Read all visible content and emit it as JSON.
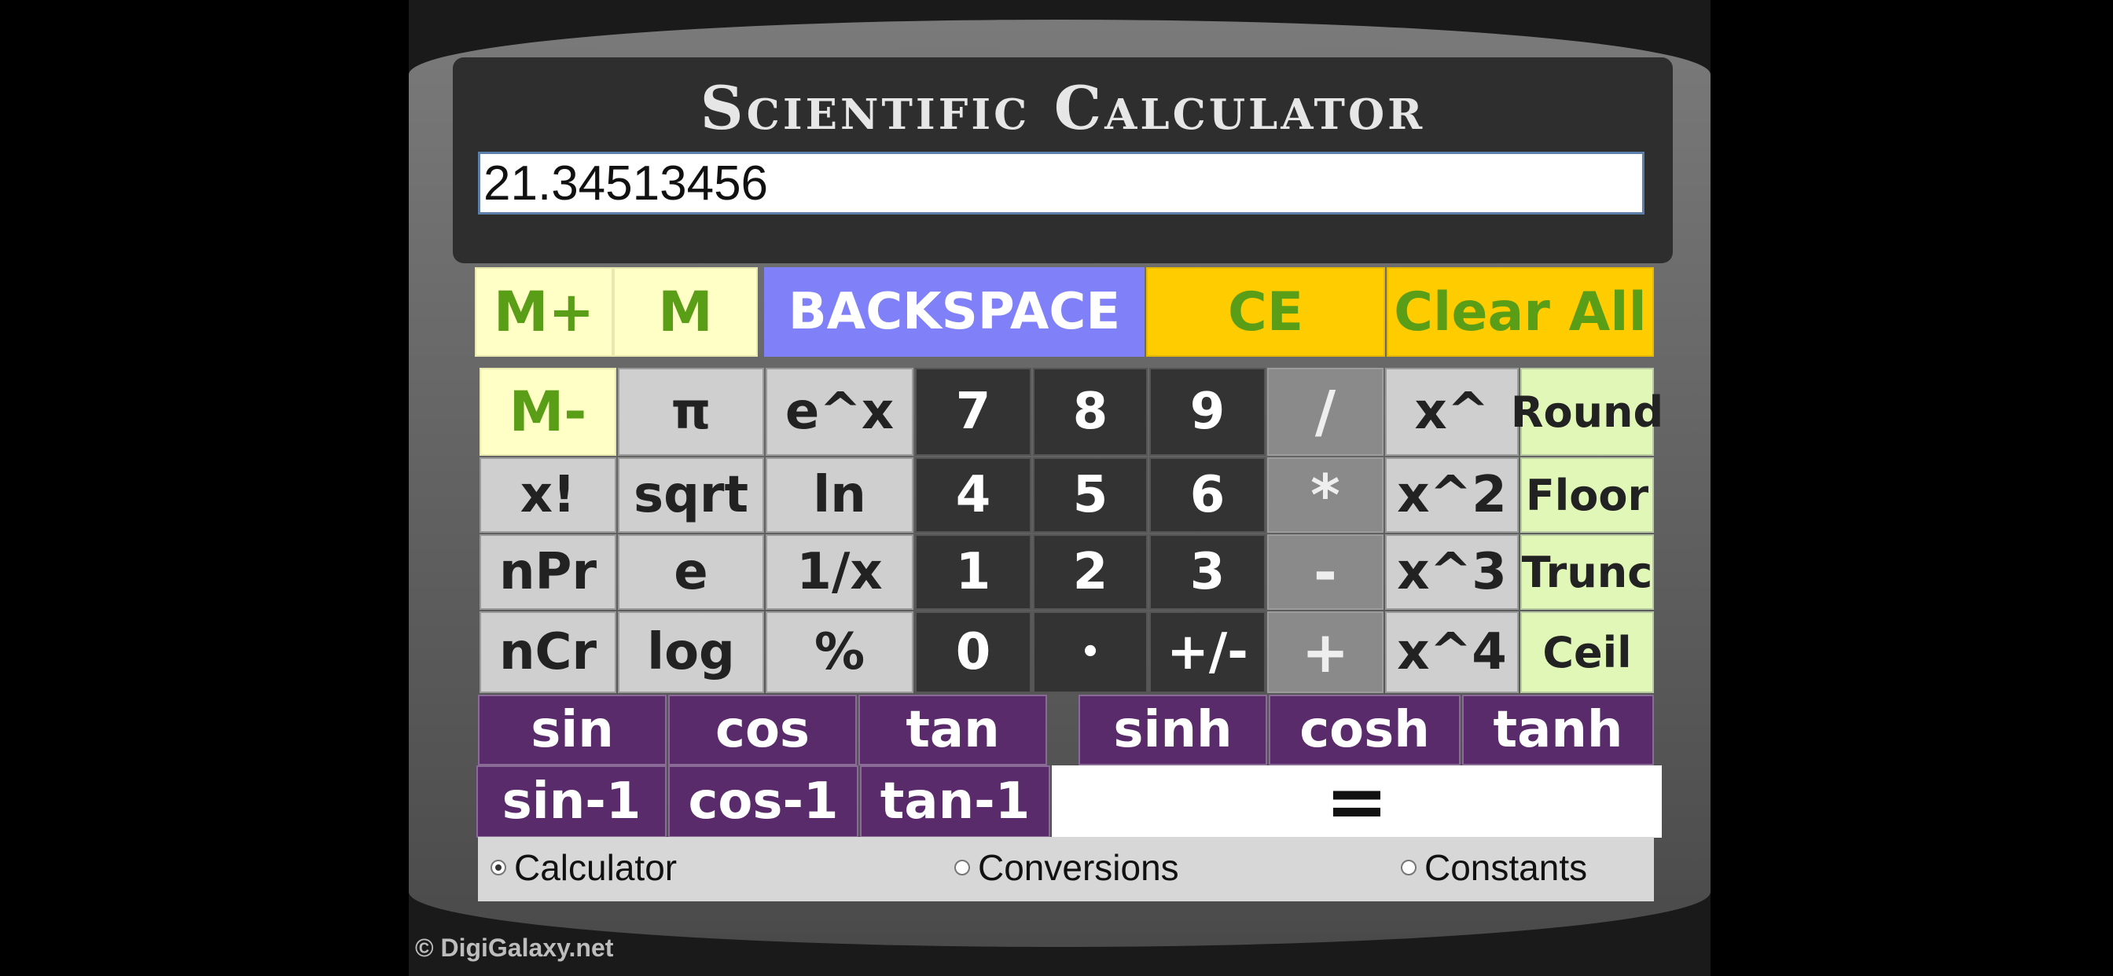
{
  "title": "Scientific Calculator",
  "display": {
    "value": "21.34513456"
  },
  "top_row": {
    "m_plus": "M+",
    "m": "M",
    "backspace": "BACKSPACE",
    "ce": "CE",
    "clear_all": "Clear All"
  },
  "row1": [
    "M-",
    "π",
    "e^x",
    "7",
    "8",
    "9",
    "/",
    "x^",
    "Round"
  ],
  "row2": [
    "x!",
    "sqrt",
    "ln",
    "4",
    "5",
    "6",
    "*",
    "x^2",
    "Floor"
  ],
  "row3": [
    "nPr",
    "e",
    "1/x",
    "1",
    "2",
    "3",
    "-",
    "x^3",
    "Trunc"
  ],
  "row4": [
    "nCr",
    "log",
    "%",
    "0",
    "•",
    "+/-",
    "+",
    "x^4",
    "Ceil"
  ],
  "trig_row1": [
    "sin",
    "cos",
    "tan",
    "sinh",
    "cosh",
    "tanh"
  ],
  "trig_row2": [
    "sin-1",
    "cos-1",
    "tan-1"
  ],
  "equals": "=",
  "modes": {
    "calculator": "Calculator",
    "conversions": "Conversions",
    "constants": "Constants",
    "selected": "calculator"
  },
  "footer": "© DigiGalaxy.net",
  "colors": {
    "memory": "#ffffc6",
    "backspace": "#8080f8",
    "amber": "#ffcc00",
    "number": "#333333",
    "operator": "#8a8a8a",
    "rounding": "#e0f7b8",
    "trig": "#5a2b6b"
  }
}
